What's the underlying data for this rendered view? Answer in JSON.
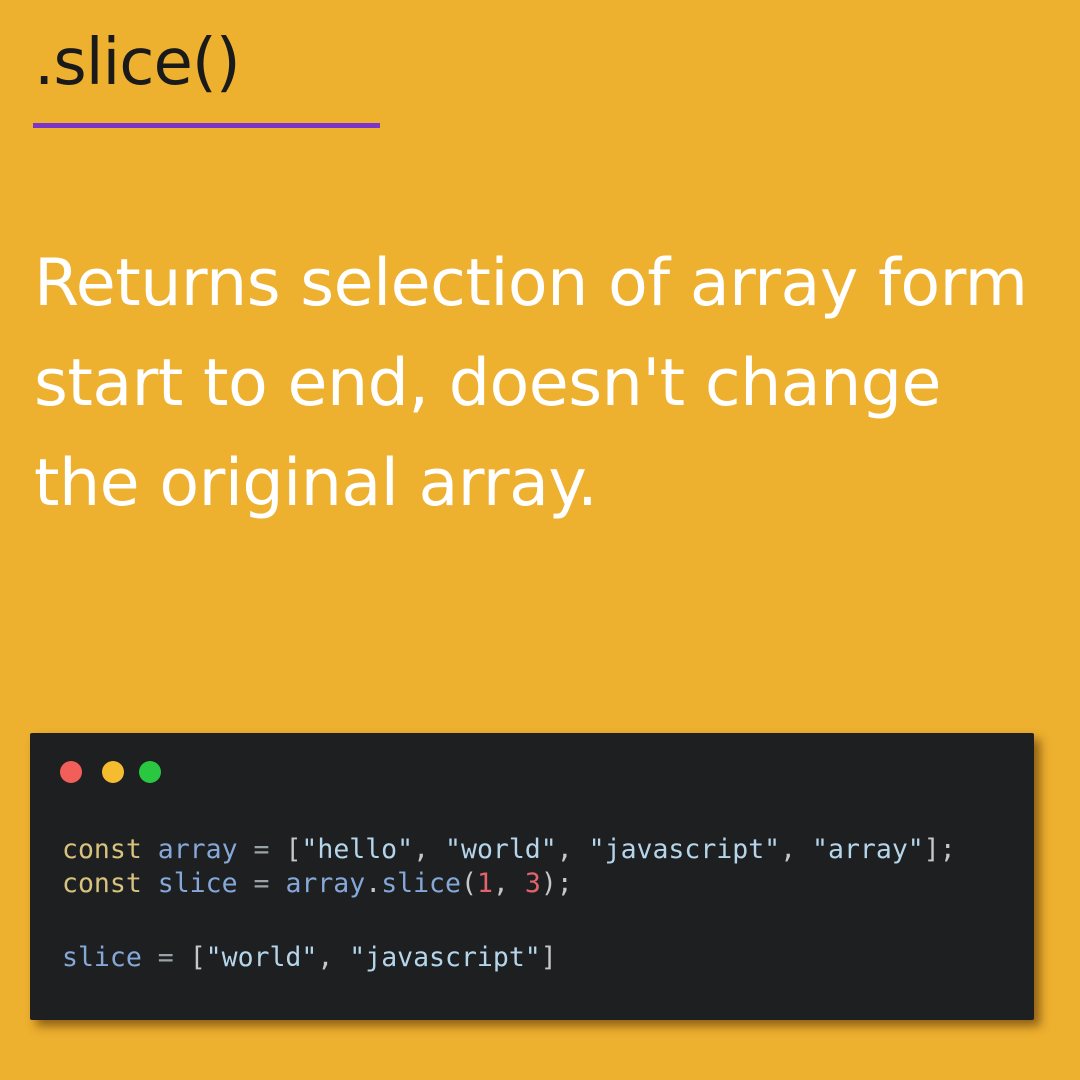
{
  "title": ".slice()",
  "description": "Returns selection of array form start to end, doesn't change the original array.",
  "colors": {
    "background": "#EEB02F",
    "underline": "#7B35C9",
    "code_background": "#1D1F21",
    "dot_red": "#F25F58",
    "dot_yellow": "#F5BC2F",
    "dot_green": "#29C840"
  },
  "code": {
    "line1": {
      "kw": "const",
      "name": "array",
      "eq": "=",
      "open": "[",
      "s1": "\"hello\"",
      "c1": ",",
      "s2": "\"world\"",
      "c2": ",",
      "s3": "\"javascript\"",
      "c3": ",",
      "s4": "\"array\"",
      "close": "];"
    },
    "line2": {
      "kw": "const",
      "name": "slice",
      "eq": "=",
      "obj": "array",
      "dot": ".",
      "method": "slice",
      "paren_open": "(",
      "arg1": "1",
      "comma": ",",
      "arg2": "3",
      "paren_close": ");"
    },
    "line3": {
      "name": "slice",
      "eq": "=",
      "open": "[",
      "s1": "\"world\"",
      "c1": ",",
      "s2": "\"javascript\"",
      "close": "]"
    }
  }
}
